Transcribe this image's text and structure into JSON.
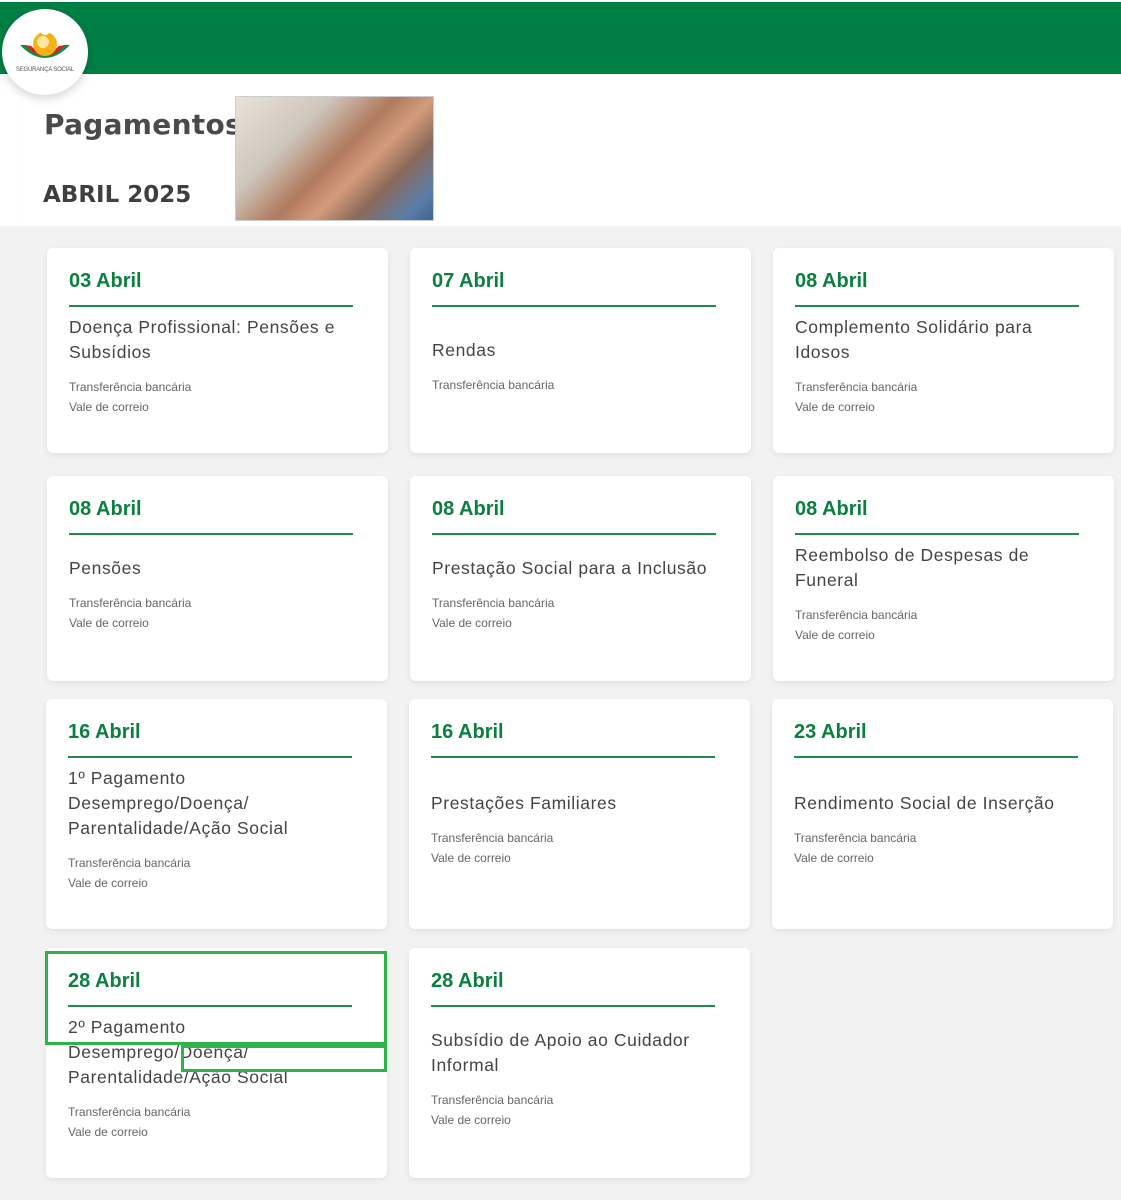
{
  "header": {
    "logo_text": "SEGURANÇA SOCIAL",
    "page_title": "Pagamentos",
    "month": "ABRIL 2025",
    "colors": {
      "brand": "#007f44",
      "accent": "#0b7f3f"
    }
  },
  "payment_methods": {
    "transfer": "Transferência bancária",
    "mail": "Vale de correio"
  },
  "cards": [
    {
      "date": "03 Abril",
      "title": "Doença Profissional: Pensões e Subsídios",
      "methods": [
        "Transferência bancária",
        "Vale de correio"
      ]
    },
    {
      "date": "07 Abril",
      "title": "Rendas",
      "methods": [
        "Transferência bancária"
      ]
    },
    {
      "date": "08 Abril",
      "title": "Complemento Solidário para Idosos",
      "methods": [
        "Transferência bancária",
        "Vale de correio"
      ]
    },
    {
      "date": "08 Abril",
      "title": "Pensões",
      "methods": [
        "Transferência bancária",
        "Vale de correio"
      ]
    },
    {
      "date": "08 Abril",
      "title": "Prestação Social para a Inclusão",
      "methods": [
        "Transferência bancária",
        "Vale de correio"
      ]
    },
    {
      "date": "08 Abril",
      "title": "Reembolso de Despesas de Funeral",
      "methods": [
        "Transferência bancária",
        "Vale de correio"
      ]
    },
    {
      "date": "16 Abril",
      "title": "1º Pagamento Desemprego/Doença/ Parentalidade/Ação Social",
      "methods": [
        "Transferência bancária",
        "Vale de correio"
      ]
    },
    {
      "date": "16 Abril",
      "title": "Prestações Familiares",
      "methods": [
        "Transferência bancária",
        "Vale de correio"
      ]
    },
    {
      "date": "23 Abril",
      "title": "Rendimento Social de Inserção",
      "methods": [
        "Transferência bancária",
        "Vale de correio"
      ]
    },
    {
      "date": "28 Abril",
      "title": "2º Pagamento Desemprego/Doença/ Parentalidade/Ação Social",
      "methods": [
        "Transferência bancária",
        "Vale de correio"
      ]
    },
    {
      "date": "28 Abril",
      "title": "Subsídio de Apoio ao Cuidador Informal",
      "methods": [
        "Transferência bancária",
        "Vale de correio"
      ]
    }
  ]
}
